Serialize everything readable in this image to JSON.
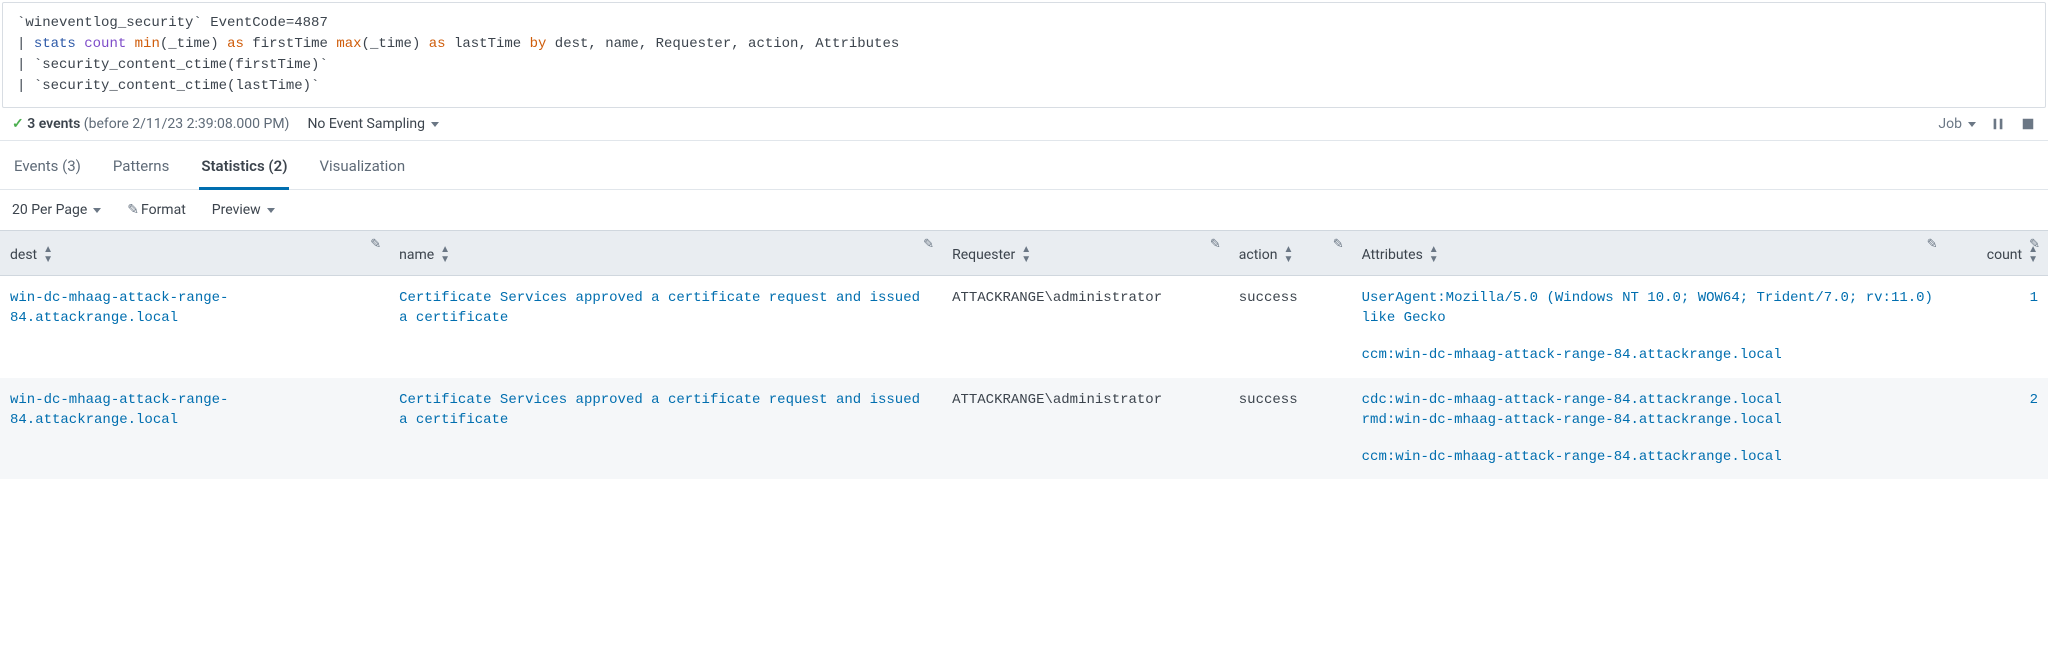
{
  "query": {
    "lines": [
      [
        {
          "t": "`wineventlog_security`",
          "c": "tok-macro"
        },
        {
          "t": " EventCode=4887",
          "c": ""
        }
      ],
      [
        {
          "t": "| ",
          "c": ""
        },
        {
          "t": "stats",
          "c": "tok-cmd"
        },
        {
          "t": " ",
          "c": ""
        },
        {
          "t": "count",
          "c": "tok-purple"
        },
        {
          "t": " ",
          "c": ""
        },
        {
          "t": "min",
          "c": "tok-func"
        },
        {
          "t": "(_time) ",
          "c": ""
        },
        {
          "t": "as",
          "c": "tok-kw"
        },
        {
          "t": " firstTime ",
          "c": ""
        },
        {
          "t": "max",
          "c": "tok-func"
        },
        {
          "t": "(_time) ",
          "c": ""
        },
        {
          "t": "as",
          "c": "tok-kw"
        },
        {
          "t": " lastTime ",
          "c": ""
        },
        {
          "t": "by",
          "c": "tok-kw"
        },
        {
          "t": " dest, name, Requester, action, Attributes",
          "c": ""
        }
      ],
      [
        {
          "t": "| ",
          "c": ""
        },
        {
          "t": "`security_content_ctime(firstTime)`",
          "c": "tok-macro"
        }
      ],
      [
        {
          "t": "| ",
          "c": ""
        },
        {
          "t": "`security_content_ctime(lastTime)`",
          "c": "tok-macro"
        }
      ]
    ]
  },
  "status": {
    "check": "✓",
    "events_count": "3 events",
    "events_suffix": " (before 2/11/23 2:39:08.000 PM)",
    "sampling": "No Event Sampling",
    "job": "Job"
  },
  "tabs": [
    {
      "label": "Events (3)",
      "active": false,
      "key": "events"
    },
    {
      "label": "Patterns",
      "active": false,
      "key": "patterns"
    },
    {
      "label": "Statistics (2)",
      "active": true,
      "key": "statistics"
    },
    {
      "label": "Visualization",
      "active": false,
      "key": "visualization"
    }
  ],
  "toolbar": {
    "per_page": "20 Per Page",
    "format": "Format",
    "preview": "Preview"
  },
  "table": {
    "columns": [
      {
        "key": "dest",
        "label": "dest",
        "align": "left"
      },
      {
        "key": "name",
        "label": "name",
        "align": "left"
      },
      {
        "key": "requester",
        "label": "Requester",
        "align": "left"
      },
      {
        "key": "action",
        "label": "action",
        "align": "left"
      },
      {
        "key": "attributes",
        "label": "Attributes",
        "align": "left"
      },
      {
        "key": "count",
        "label": "count",
        "align": "right"
      }
    ],
    "rows": [
      {
        "dest": "win-dc-mhaag-attack-range-84.attackrange.local",
        "name": "Certificate Services approved a certificate request and issued a certificate",
        "requester": "ATTACKRANGE\\administrator",
        "action": "success",
        "attributes": [
          "UserAgent:Mozilla/5.0 (Windows NT 10.0; WOW64; Trident/7.0; rv:11.0) like Gecko",
          "",
          "ccm:win-dc-mhaag-attack-range-84.attackrange.local"
        ],
        "count": "1"
      },
      {
        "dest": "win-dc-mhaag-attack-range-84.attackrange.local",
        "name": "Certificate Services approved a certificate request and issued a certificate",
        "requester": "ATTACKRANGE\\administrator",
        "action": "success",
        "attributes": [
          "cdc:win-dc-mhaag-attack-range-84.attackrange.local",
          "rmd:win-dc-mhaag-attack-range-84.attackrange.local",
          "",
          "ccm:win-dc-mhaag-attack-range-84.attackrange.local"
        ],
        "count": "2"
      }
    ]
  }
}
